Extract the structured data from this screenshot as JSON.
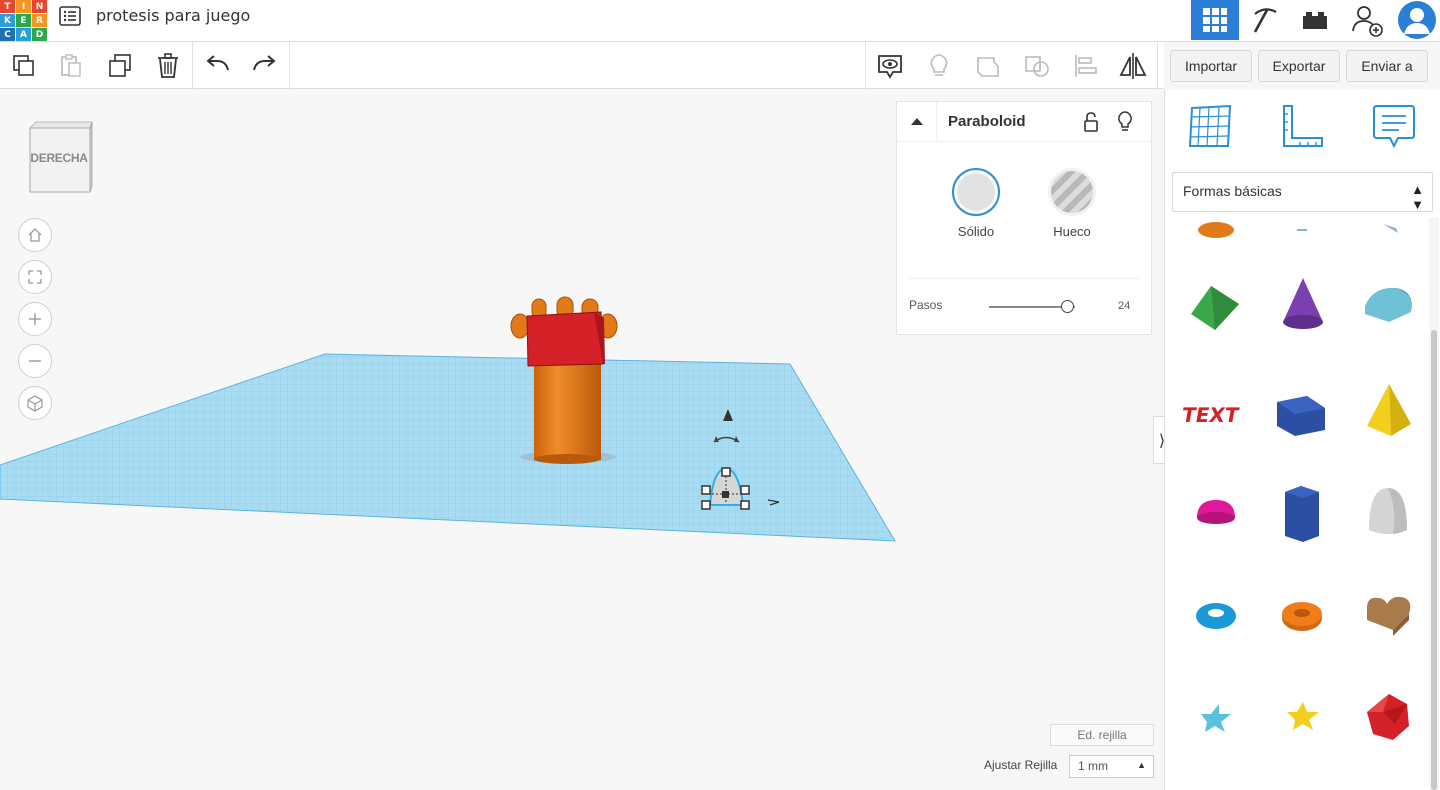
{
  "header": {
    "logo_letters": [
      "T",
      "I",
      "N",
      "K",
      "E",
      "R",
      "C",
      "A",
      "D"
    ],
    "project_title": "protesis para juego",
    "icons": [
      "menu-list-icon",
      "grid-view-icon",
      "pickaxe-icon",
      "bricks-icon",
      "add-user-icon",
      "avatar-icon"
    ]
  },
  "toolbar": {
    "icons": [
      "copy-icon",
      "paste-icon",
      "duplicate-icon",
      "delete-icon",
      "undo-icon",
      "redo-icon",
      "note-view-icon",
      "lightbulb-icon",
      "group-icon",
      "ungroup-icon",
      "align-icon",
      "mirror-icon"
    ],
    "import_label": "Importar",
    "export_label": "Exportar",
    "send_label": "Enviar a"
  },
  "viewcube": {
    "face_label": "DERECHA"
  },
  "inspector": {
    "shape_name": "Paraboloid",
    "solid_label": "Sólido",
    "hole_label": "Hueco",
    "steps_label": "Pasos",
    "steps_value": "24",
    "steps_fraction": 0.92
  },
  "grid_controls": {
    "edit_grid_label": "Ed. rejilla",
    "snap_label": "Ajustar Rejilla",
    "snap_value": "1 mm"
  },
  "sidebar": {
    "tabs": [
      "workplane-grid-icon",
      "ruler-icon",
      "notes-icon"
    ],
    "category_value": "Formas básicas",
    "shapes": [
      {
        "name": "roof",
        "color": "#3aa84a"
      },
      {
        "name": "cone",
        "color": "#7b3fb0"
      },
      {
        "name": "round-roof",
        "color": "#6fc2d6"
      },
      {
        "name": "text",
        "color": "#d42128"
      },
      {
        "name": "box",
        "color": "#2c4fa3"
      },
      {
        "name": "pyramid",
        "color": "#f2cf1d"
      },
      {
        "name": "half-sphere",
        "color": "#e0199b"
      },
      {
        "name": "polygon",
        "color": "#2c4fa3"
      },
      {
        "name": "paraboloid",
        "color": "#d4d4d4"
      },
      {
        "name": "torus",
        "color": "#1b98d6"
      },
      {
        "name": "tube",
        "color": "#f07d19"
      },
      {
        "name": "heart",
        "color": "#a87a4c"
      },
      {
        "name": "star",
        "color": "#5bc0de"
      },
      {
        "name": "star-gold",
        "color": "#f2cf1d"
      },
      {
        "name": "icosahedron",
        "color": "#d42128"
      }
    ]
  }
}
